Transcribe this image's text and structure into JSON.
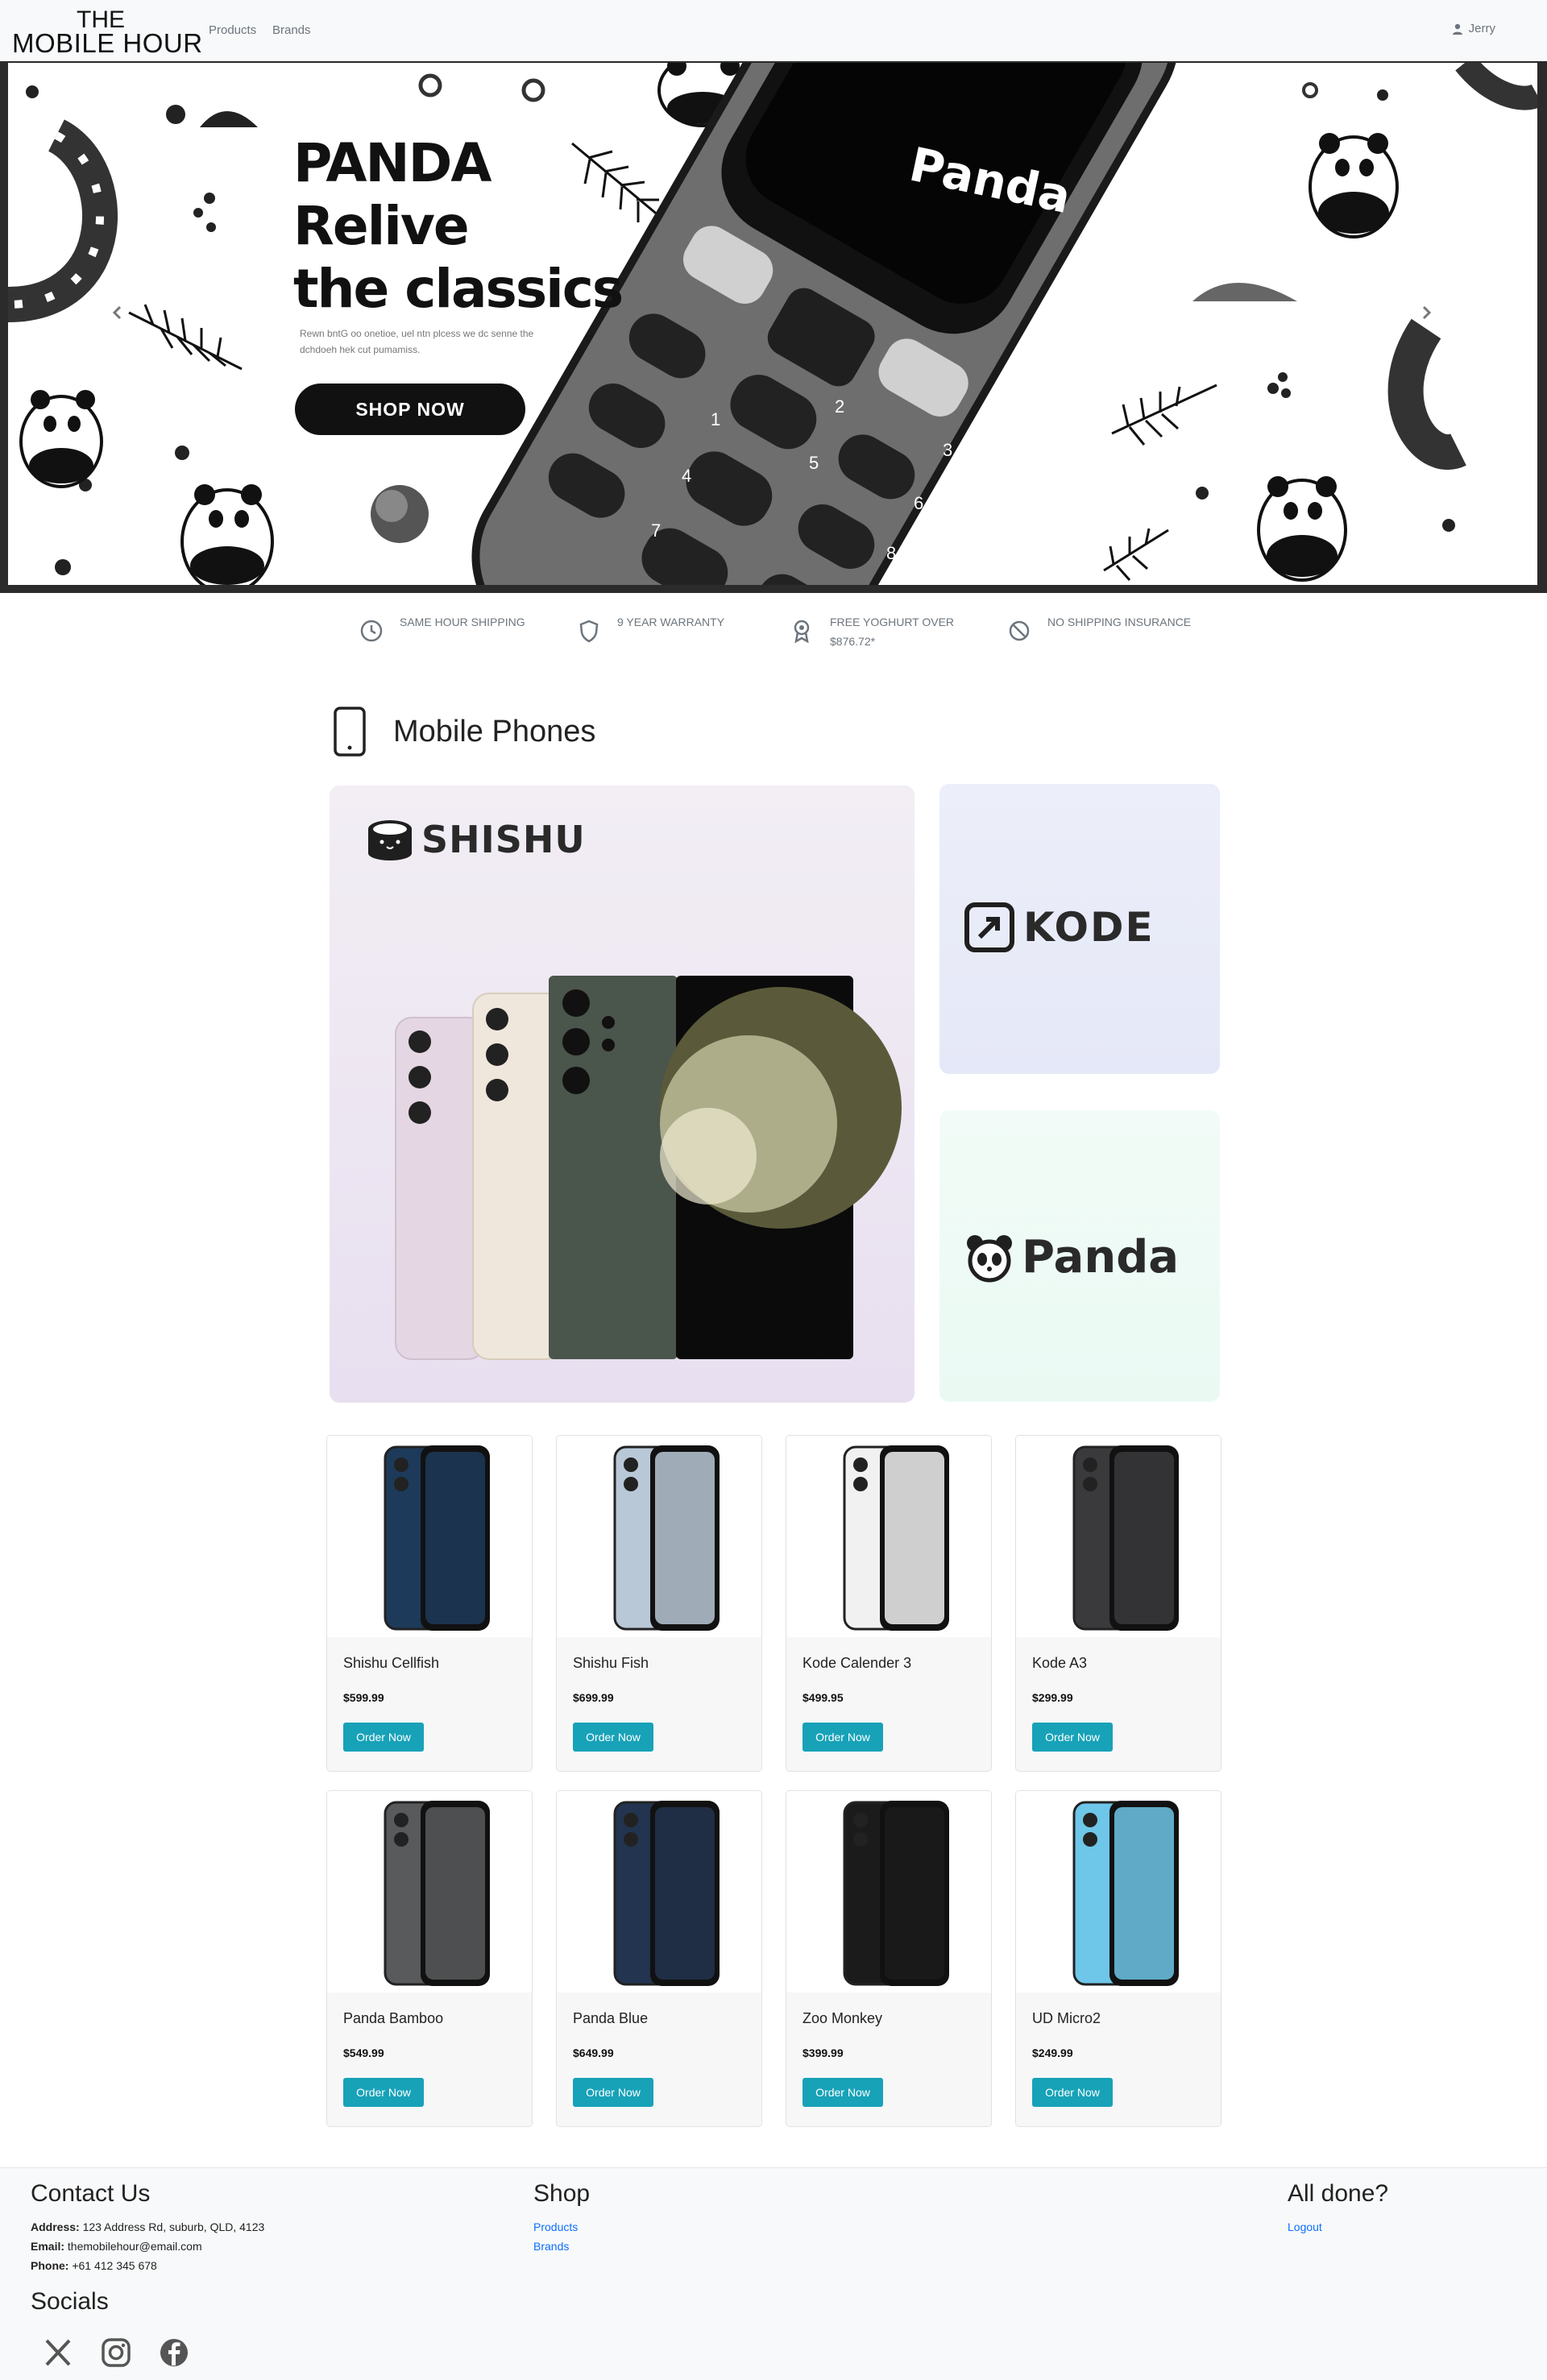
{
  "navbar": {
    "brand_line1": "THE",
    "brand_line2": "MOBILE HOUR",
    "links": [
      "Products",
      "Brands"
    ],
    "user_name": "Jerry",
    "user_icon": "person-icon"
  },
  "hero": {
    "headline": [
      "PANDA",
      "Relive",
      "the classics"
    ],
    "subtext": "Rewn bntG oo onetioe, uel ntn plcess we dc senne the dchdoeh hek cut pumamiss.",
    "button_label": "SHOP NOW",
    "phone_screen_text": "Panda",
    "keypad": [
      "1",
      "2",
      "3",
      "4",
      "5",
      "6",
      "7",
      "8"
    ],
    "prev_icon": "chevron-left-icon",
    "next_icon": "chevron-right-icon"
  },
  "features": [
    {
      "label": "SAME HOUR SHIPPING",
      "icon": "clock-icon"
    },
    {
      "label": "9 YEAR WARRANTY",
      "icon": "shield-icon"
    },
    {
      "label": "FREE YOGHURT OVER",
      "label2": "$876.72*",
      "icon": "award-icon"
    },
    {
      "label": "NO SHIPPING INSURANCE",
      "icon": "ban-icon"
    }
  ],
  "section": {
    "title": "Mobile Phones",
    "icon": "phone-icon"
  },
  "brands": [
    {
      "name": "SHISHU",
      "icon": "sushi-icon"
    },
    {
      "name": "KODE",
      "icon": "arrow-box-icon"
    },
    {
      "name": "Panda",
      "icon": "panda-icon"
    }
  ],
  "products": [
    {
      "name": "Shishu Cellfish",
      "price": "$599.99",
      "button": "Order Now",
      "color": "#1d3a5a"
    },
    {
      "name": "Shishu Fish",
      "price": "$699.99",
      "button": "Order Now",
      "color": "#b9c8d6"
    },
    {
      "name": "Kode Calender 3",
      "price": "$499.95",
      "button": "Order Now",
      "color": "#f1f1f1"
    },
    {
      "name": "Kode A3",
      "price": "$299.99",
      "button": "Order Now",
      "color": "#3a3a3c"
    },
    {
      "name": "Panda Bamboo",
      "price": "$549.99",
      "button": "Order Now",
      "color": "#585a5c"
    },
    {
      "name": "Panda Blue",
      "price": "$649.99",
      "button": "Order Now",
      "color": "#22344f"
    },
    {
      "name": "Zoo Monkey",
      "price": "$399.99",
      "button": "Order Now",
      "color": "#1b1b1b"
    },
    {
      "name": "UD Micro2",
      "price": "$249.99",
      "button": "Order Now",
      "color": "#6ec6e8"
    }
  ],
  "footer": {
    "contact_title": "Contact Us",
    "address_label": "Address:",
    "address": "123 Address Rd, suburb, QLD, 4123",
    "email_label": "Email:",
    "email": "themobilehour@email.com",
    "phone_label": "Phone:",
    "phone": "+61 412 345 678",
    "socials_title": "Socials",
    "socials": [
      "x-icon",
      "instagram-icon",
      "facebook-icon"
    ],
    "shop_title": "Shop",
    "shop_links": [
      "Products",
      "Brands"
    ],
    "done_title": "All done?",
    "logout": "Logout"
  },
  "colors": {
    "accent": "#17a2b8",
    "link": "#0d6efd",
    "navbar_bg": "#f8f9fa"
  }
}
